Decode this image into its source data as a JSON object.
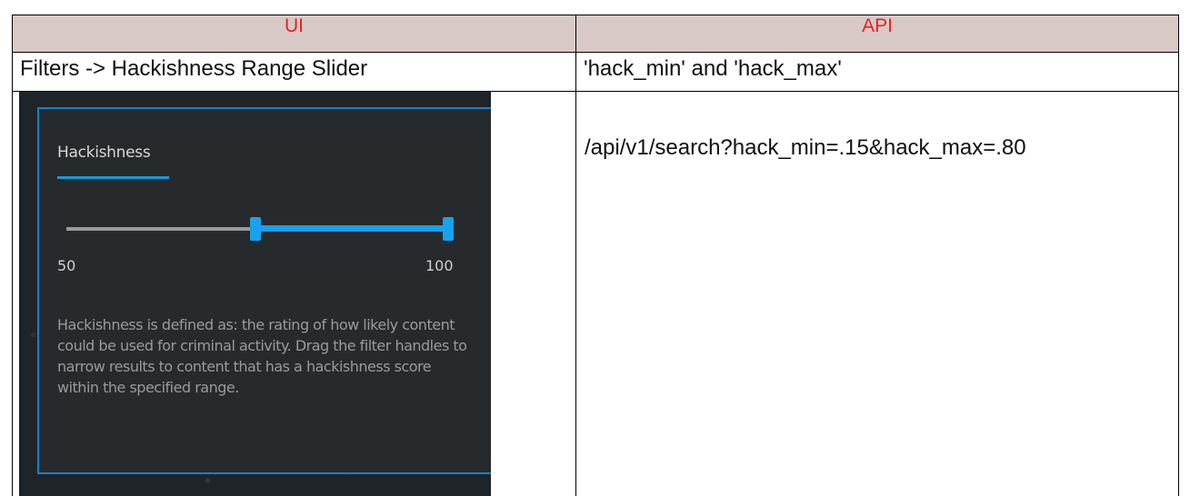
{
  "table": {
    "headers": [
      "UI",
      "API"
    ],
    "row1": {
      "ui": "Filters -> Hackishness Range Slider",
      "api": "'hack_min' and 'hack_max'"
    },
    "row2": {
      "api": "/api/v1/search?hack_min=.15&hack_max=.80"
    }
  },
  "panel": {
    "title": "Hackishness",
    "range_min_label": "50",
    "range_max_label": "100",
    "selected_min_fraction": 0.5,
    "selected_max_fraction": 1.0,
    "description": "Hackishness is defined as: the rating of how likely content could be used for criminal activity. Drag the filter handles to narrow results to content that has a hackishness score within the specified range."
  },
  "colors": {
    "header_bg": "#d9c9c6",
    "header_text": "#e02424",
    "panel_bg": "#262a2d",
    "accent": "#16a2ef"
  }
}
